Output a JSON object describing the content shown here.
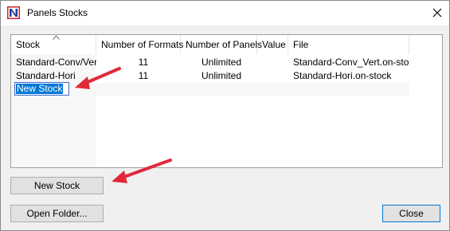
{
  "window": {
    "title": "Panels Stocks",
    "app_icon": "N-logo-icon"
  },
  "colors": {
    "arrow": "#e02a3a",
    "selection": "#0078d7",
    "app_icon_red": "#d7202a",
    "app_icon_blue": "#1f3fa0"
  },
  "list": {
    "columns": [
      "Stock",
      "Number of Formats",
      "Number of Panels",
      "Value",
      "File"
    ],
    "rows": [
      {
        "stock": "Standard-Conv/Vert",
        "formats": "11",
        "panels": "Unlimited",
        "value": "",
        "file": "Standard-Conv_Vert.on-stock"
      },
      {
        "stock": "Standard-Hori",
        "formats": "11",
        "panels": "Unlimited",
        "value": "",
        "file": "Standard-Hori.on-stock"
      }
    ],
    "editing_value": "New Stock"
  },
  "buttons": {
    "new_stock": "New Stock",
    "open_folder": "Open Folder...",
    "close": "Close"
  }
}
